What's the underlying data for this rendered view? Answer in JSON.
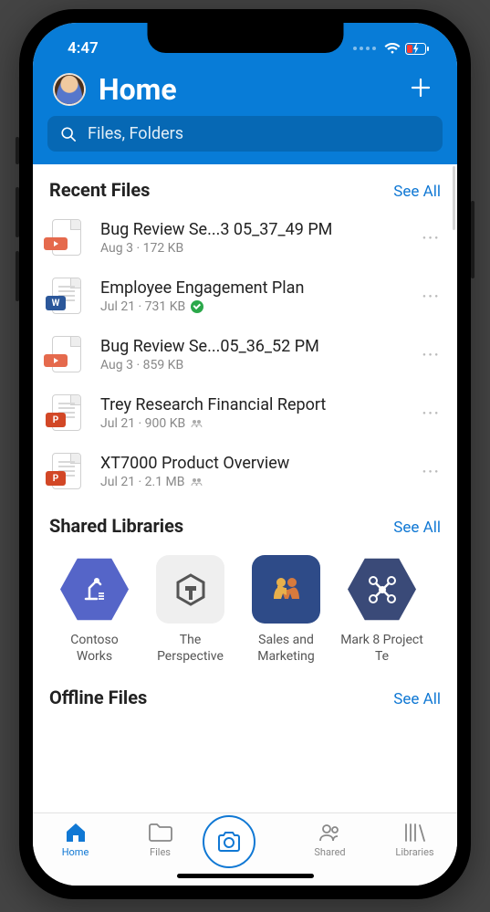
{
  "status": {
    "time": "4:47"
  },
  "header": {
    "title": "Home",
    "search_placeholder": "Files, Folders"
  },
  "sections": {
    "recent": {
      "title": "Recent Files",
      "see_all": "See All"
    },
    "shared_libs": {
      "title": "Shared Libraries",
      "see_all": "See All"
    },
    "offline": {
      "title": "Offline Files",
      "see_all": "See All"
    }
  },
  "recent_files": [
    {
      "name": "Bug Review Se...3 05_37_49 PM",
      "meta": "Aug 3 · 172 KB",
      "type": "recording"
    },
    {
      "name": "Employee Engagement Plan",
      "meta": "Jul 21 · 731 KB",
      "type": "word",
      "synced": true
    },
    {
      "name": "Bug Review Se...05_36_52 PM",
      "meta": "Aug 3 · 859 KB",
      "type": "recording"
    },
    {
      "name": "Trey Research Financial Report",
      "meta": "Jul 21 · 900 KB",
      "type": "ppt",
      "shared": true
    },
    {
      "name": "XT7000 Product Overview",
      "meta": "Jul 21 · 2.1 MB",
      "type": "ppt",
      "shared": true
    }
  ],
  "libraries": [
    {
      "name": "Contoso Works",
      "color": "#5565C8",
      "shape": "hex",
      "glyph": "robot"
    },
    {
      "name": "The Perspective",
      "color": "#EFEFEF",
      "shape": "square",
      "glyph": "t-logo"
    },
    {
      "name": "Sales and Marketing",
      "color": "#2E4B88",
      "shape": "square",
      "glyph": "people"
    },
    {
      "name": "Mark 8 Project Te",
      "color": "#3A4A78",
      "shape": "hex",
      "glyph": "drone"
    }
  ],
  "tabs": {
    "home": "Home",
    "files": "Files",
    "shared": "Shared",
    "libraries": "Libraries"
  }
}
